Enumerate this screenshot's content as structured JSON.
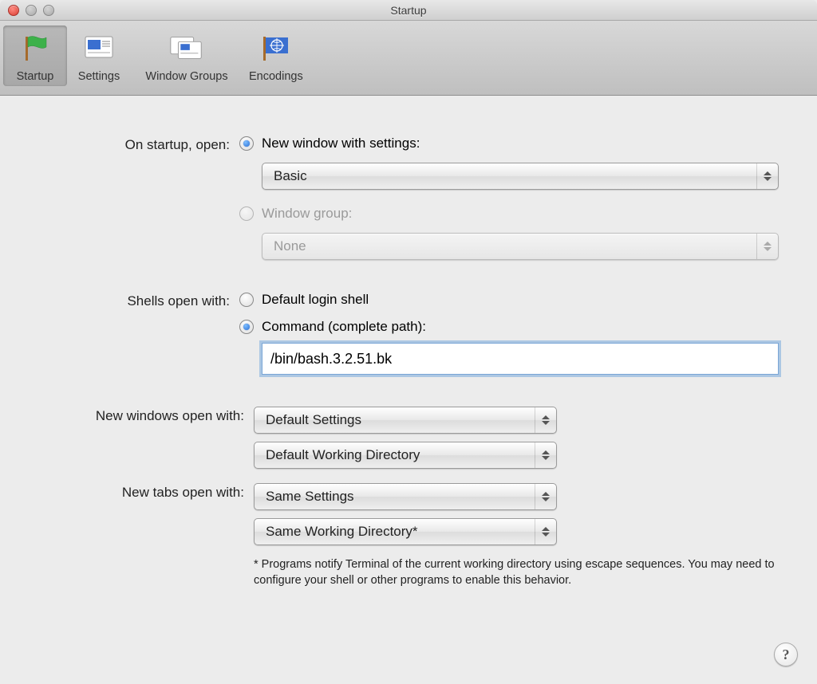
{
  "window": {
    "title": "Startup"
  },
  "toolbar": {
    "items": [
      {
        "label": "Startup",
        "icon": "flag-icon",
        "selected": true
      },
      {
        "label": "Settings",
        "icon": "settings-doc-icon",
        "selected": false
      },
      {
        "label": "Window Groups",
        "icon": "window-groups-icon",
        "selected": false
      },
      {
        "label": "Encodings",
        "icon": "encodings-flag-icon",
        "selected": false
      }
    ]
  },
  "startup": {
    "label_on_startup_open": "On startup, open:",
    "option_new_window": "New window with settings:",
    "new_window_settings_value": "Basic",
    "option_window_group": "Window group:",
    "window_group_value": "None",
    "selected_option": "new_window"
  },
  "shells": {
    "label_shells_open_with": "Shells open with:",
    "option_default_login": "Default login shell",
    "option_command": "Command (complete path):",
    "command_value": "/bin/bash.3.2.51.bk",
    "selected_option": "command"
  },
  "new_windows": {
    "label": "New windows open with:",
    "settings_value": "Default Settings",
    "working_dir_value": "Default Working Directory"
  },
  "new_tabs": {
    "label": "New tabs open with:",
    "settings_value": "Same Settings",
    "working_dir_value": "Same Working Directory*"
  },
  "footnote": "* Programs notify Terminal of the current working directory using escape sequences. You may need to configure your shell or other programs to enable this behavior.",
  "help_tooltip": "?"
}
